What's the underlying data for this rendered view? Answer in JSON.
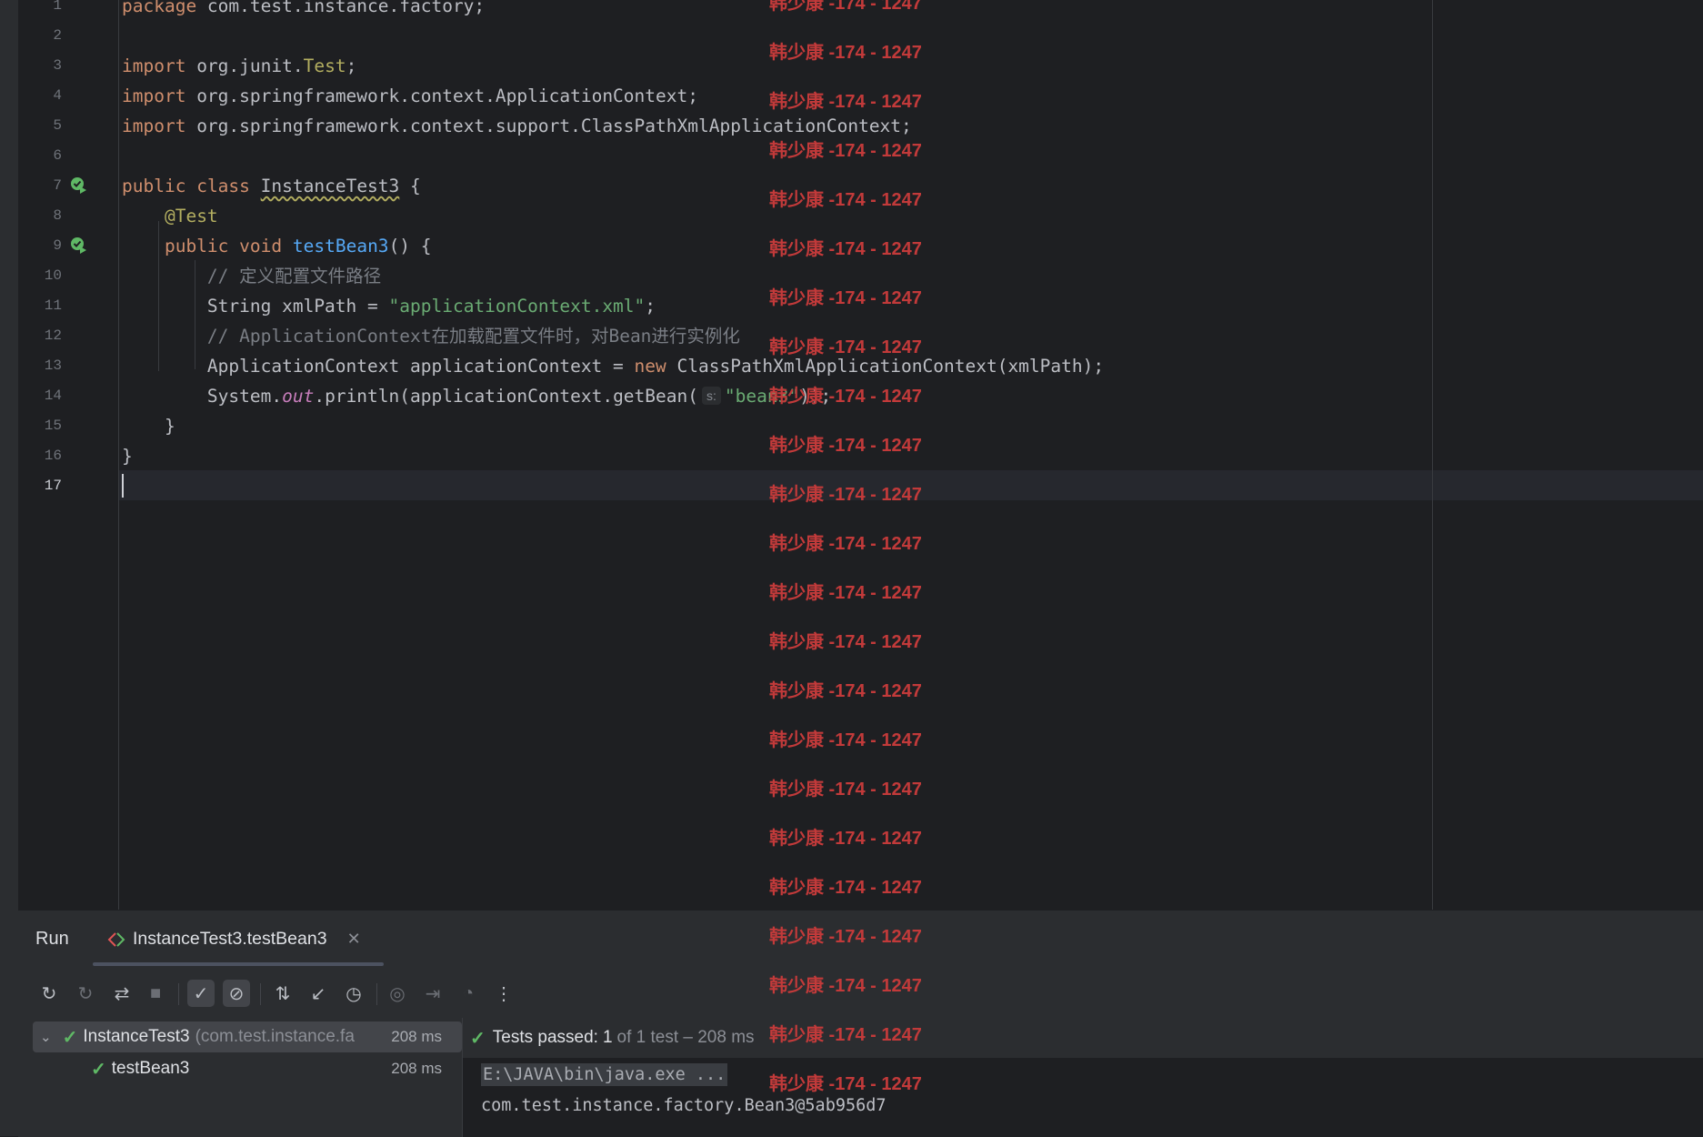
{
  "editor": {
    "current_line": "17",
    "lines": [
      {
        "n": "1",
        "text": "package com.test.instance.factory;"
      },
      {
        "n": "2",
        "text": ""
      },
      {
        "n": "3",
        "text": "import org.junit.Test;"
      },
      {
        "n": "4",
        "text": "import org.springframework.context.ApplicationContext;"
      },
      {
        "n": "5",
        "text": "import org.springframework.context.support.ClassPathXmlApplicationContext;"
      },
      {
        "n": "6",
        "text": ""
      },
      {
        "n": "7",
        "text": "public class InstanceTest3 {"
      },
      {
        "n": "8",
        "text": "    @Test"
      },
      {
        "n": "9",
        "text": "    public void testBean3() {"
      },
      {
        "n": "10",
        "text": "        // 定义配置文件路径"
      },
      {
        "n": "11",
        "text": "        String xmlPath = \"applicationContext.xml\";"
      },
      {
        "n": "12",
        "text": "        // ApplicationContext在加载配置文件时，对Bean进行实例化"
      },
      {
        "n": "13",
        "text": "        ApplicationContext applicationContext = new ClassPathXmlApplicationContext(xmlPath);"
      },
      {
        "n": "14",
        "text": "        System.out.println(applicationContext.getBean( s: \"bean3\"));"
      },
      {
        "n": "15",
        "text": "    }"
      },
      {
        "n": "16",
        "text": "}"
      },
      {
        "n": "17",
        "text": ""
      }
    ],
    "tokens": {
      "package_kw": "package",
      "package_name": " com.test.instance.factory;",
      "import_kw": "import",
      "import_1_pre": " org.junit.",
      "import_1_cls": "Test",
      "import_1_post": ";",
      "import_2": " org.springframework.context.ApplicationContext;",
      "import_3": " org.springframework.context.support.ClassPathXmlApplicationContext;",
      "public_kw": "public",
      "class_kw": "class",
      "class_name": "InstanceTest3",
      "brace_open": " {",
      "annotation": "@Test",
      "void_kw": "void",
      "method_name": "testBean3",
      "method_sig": "() {",
      "comment_1": "// 定义配置文件路径",
      "string_type": "String xmlPath = ",
      "xml_path_value": "\"applicationContext.xml\"",
      "semicolon": ";",
      "comment_2": "// ApplicationContext在加载配置文件时，对Bean进行实例化",
      "ctx_decl": "ApplicationContext applicationContext = ",
      "new_kw": "new",
      "ctx_init": " ClassPathXmlApplicationContext(xmlPath);",
      "sysout_pre": "System.",
      "sysout_out": "out",
      "sysout_mid": ".println(applicationContext.getBean(",
      "param_hint": "s:",
      "bean_name": "\"bean3\"",
      "sysout_post": "));",
      "close_method": "}",
      "close_class": "}"
    }
  },
  "watermark": {
    "text": "韩少康 -174 - 1247",
    "color": "#c23a3a",
    "repeat_count": 23
  },
  "run_panel": {
    "title": "Run",
    "tab_label": "InstanceTest3.testBean3",
    "toolbar": [
      {
        "name": "rerun-icon",
        "glyph": "↻"
      },
      {
        "name": "rerun-failed-icon",
        "glyph": "↻"
      },
      {
        "name": "toggle-autotest-icon",
        "glyph": "⇄"
      },
      {
        "name": "stop-icon",
        "glyph": "■"
      },
      {
        "name": "show-passed-icon",
        "glyph": "✓"
      },
      {
        "name": "show-ignored-icon",
        "glyph": "⊘"
      },
      {
        "name": "sort-alphabetically-icon",
        "glyph": "⇅"
      },
      {
        "name": "collapse-all-icon",
        "glyph": "↙"
      },
      {
        "name": "sort-by-duration-icon",
        "glyph": "◷"
      },
      {
        "name": "screenshot-icon",
        "glyph": "◎"
      },
      {
        "name": "import-tests-icon",
        "glyph": "⇥"
      },
      {
        "name": "coverage-icon",
        "glyph": "◔"
      },
      {
        "name": "more-options-icon",
        "glyph": "⋮"
      }
    ],
    "tree": {
      "root_name": "InstanceTest3",
      "root_pkg": "(com.test.instance.fa",
      "root_time": "208 ms",
      "child_name": "testBean3",
      "child_time": "208 ms"
    },
    "console": {
      "status_prefix": "Tests passed:",
      "status_count": "1",
      "status_suffix": "of 1 test – 208 ms",
      "cmd_line": "E:\\JAVA\\bin\\java.exe ...",
      "output_line": "com.test.instance.factory.Bean3@5ab956d7"
    }
  }
}
